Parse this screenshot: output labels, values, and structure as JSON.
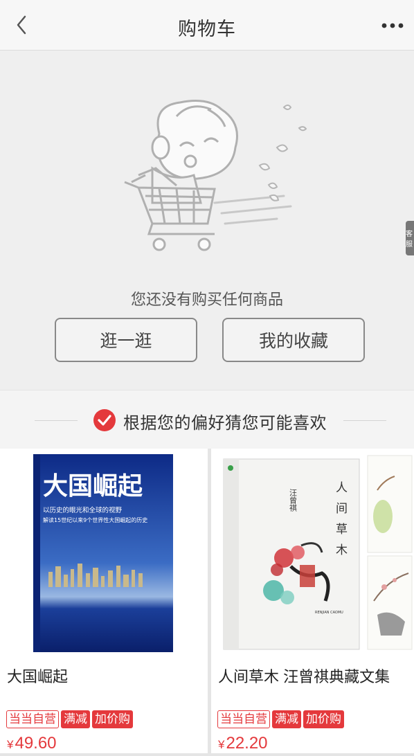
{
  "header": {
    "title": "购物车",
    "back_icon": "chevron-left-icon",
    "more_icon": "more-dots-icon"
  },
  "empty": {
    "message": "您还没有购买任何商品",
    "browse_label": "逛一逛",
    "favorites_label": "我的收藏",
    "side_tab_label": "客服"
  },
  "recommend": {
    "label": "根据您的偏好猜您可能喜欢",
    "icon": "check-circle-icon",
    "accent": "#e4393c"
  },
  "products": [
    {
      "title": "大国崛起",
      "tags": [
        "当当自营",
        "满减",
        "加价购"
      ],
      "currency": "¥",
      "price": "49.60",
      "cover_title": "大国崛起",
      "cover_subtitle1": "以历史的眼光和全球的视野",
      "cover_subtitle2": "解读15世纪以来9个世界性大国崛起的历史"
    },
    {
      "title": "人间草木 汪曾祺典藏文集",
      "tags": [
        "当当自营",
        "满减",
        "加价购"
      ],
      "currency": "¥",
      "price": "22.20",
      "cover_title_chars": [
        "人",
        "间",
        "草",
        "木"
      ],
      "cover_author": "汪曾祺",
      "cover_en": "RENJIAN CAOMU"
    }
  ]
}
